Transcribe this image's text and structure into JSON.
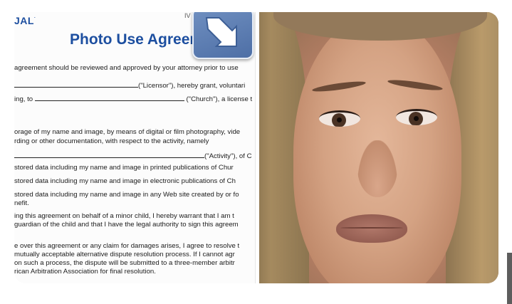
{
  "document": {
    "logo": "JAL",
    "corner_text": "IV",
    "title": "Photo Use Agreement",
    "lines": [
      {
        "text": "agreement should be reviewed and approved by your attorney prior to use"
      },
      {
        "text": "(\"Licensor\"), hereby grant, voluntari"
      },
      {
        "text": "ing, to"
      },
      {
        "text": "(\"Church\"), a license t"
      },
      {
        "text": "orage of my name and image, by means of digital or film photography, vide"
      },
      {
        "text": "rding or other documentation, with respect to the activity, namely"
      },
      {
        "text": "(\"Activity\"), of C"
      },
      {
        "text": "stored data including my name and image in printed publications of Chur"
      },
      {
        "text": "stored data including my name and image in electronic publications of Ch"
      },
      {
        "text": "stored data including my name and image in any Web site created by or fo"
      },
      {
        "text": "nefit."
      },
      {
        "text": "ing this agreement on behalf of a minor child, I hereby warrant that I am t"
      },
      {
        "text": "guardian of the child and that I have the legal authority to sign this agreem"
      },
      {
        "text": "e over this agreement or any claim for damages arises, I agree to resolve t"
      },
      {
        "text": "mutually acceptable alternative dispute resolution process.  If I cannot agr"
      },
      {
        "text": "on such a process, the dispute will be submitted to a three-member arbitr"
      },
      {
        "text": "rican Arbitration Association for final resolution."
      }
    ]
  },
  "icons": {
    "corner_arrow": "arrow-down-right-icon"
  },
  "colors": {
    "title_blue": "#1d4fa0",
    "icon_blue": "#5a7bb2"
  }
}
